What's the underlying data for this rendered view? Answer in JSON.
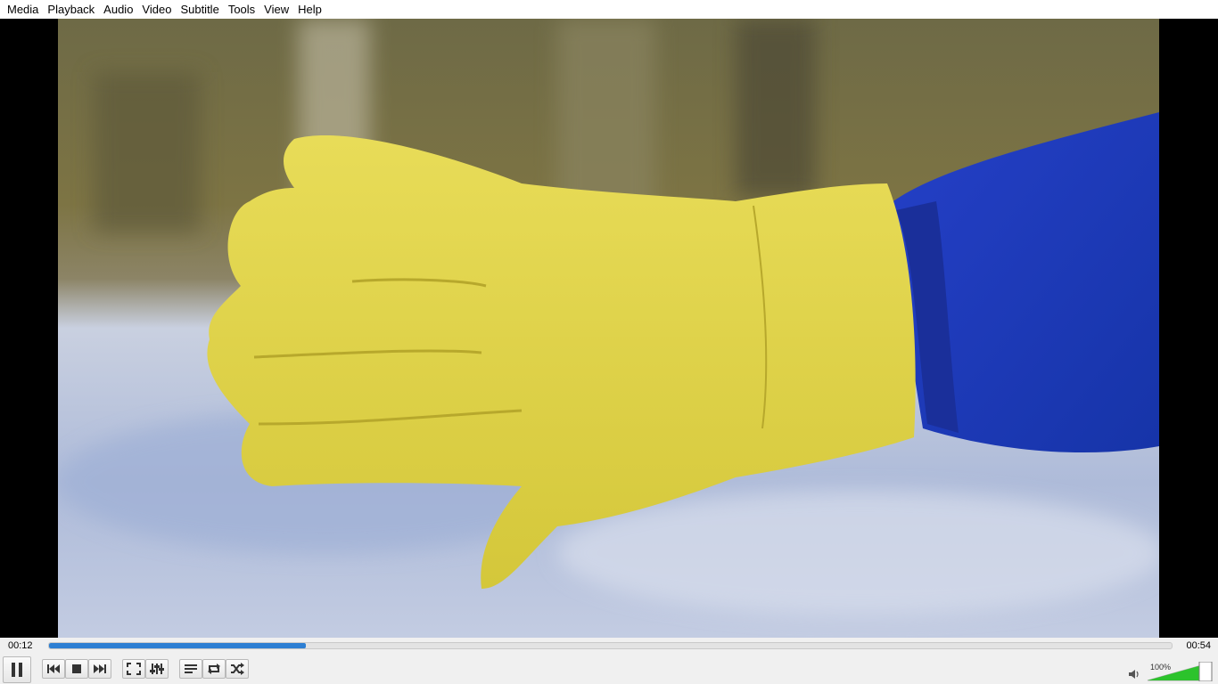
{
  "menu": {
    "items": [
      "Media",
      "Playback",
      "Audio",
      "Video",
      "Subtitle",
      "Tools",
      "View",
      "Help"
    ]
  },
  "player": {
    "elapsed": "00:12",
    "total": "00:54",
    "progress_fraction": 0.2286,
    "volume_label": "100%",
    "volume_fraction": 1.0,
    "accent_color": "#2d7fd3",
    "volume_color": "#2cc32c"
  },
  "controls": {
    "icons": [
      "pause-icon",
      "previous-icon",
      "stop-icon",
      "next-icon",
      "fullscreen-icon",
      "extended-settings-icon",
      "playlist-icon",
      "loop-icon",
      "shuffle-icon",
      "speaker-icon"
    ]
  }
}
